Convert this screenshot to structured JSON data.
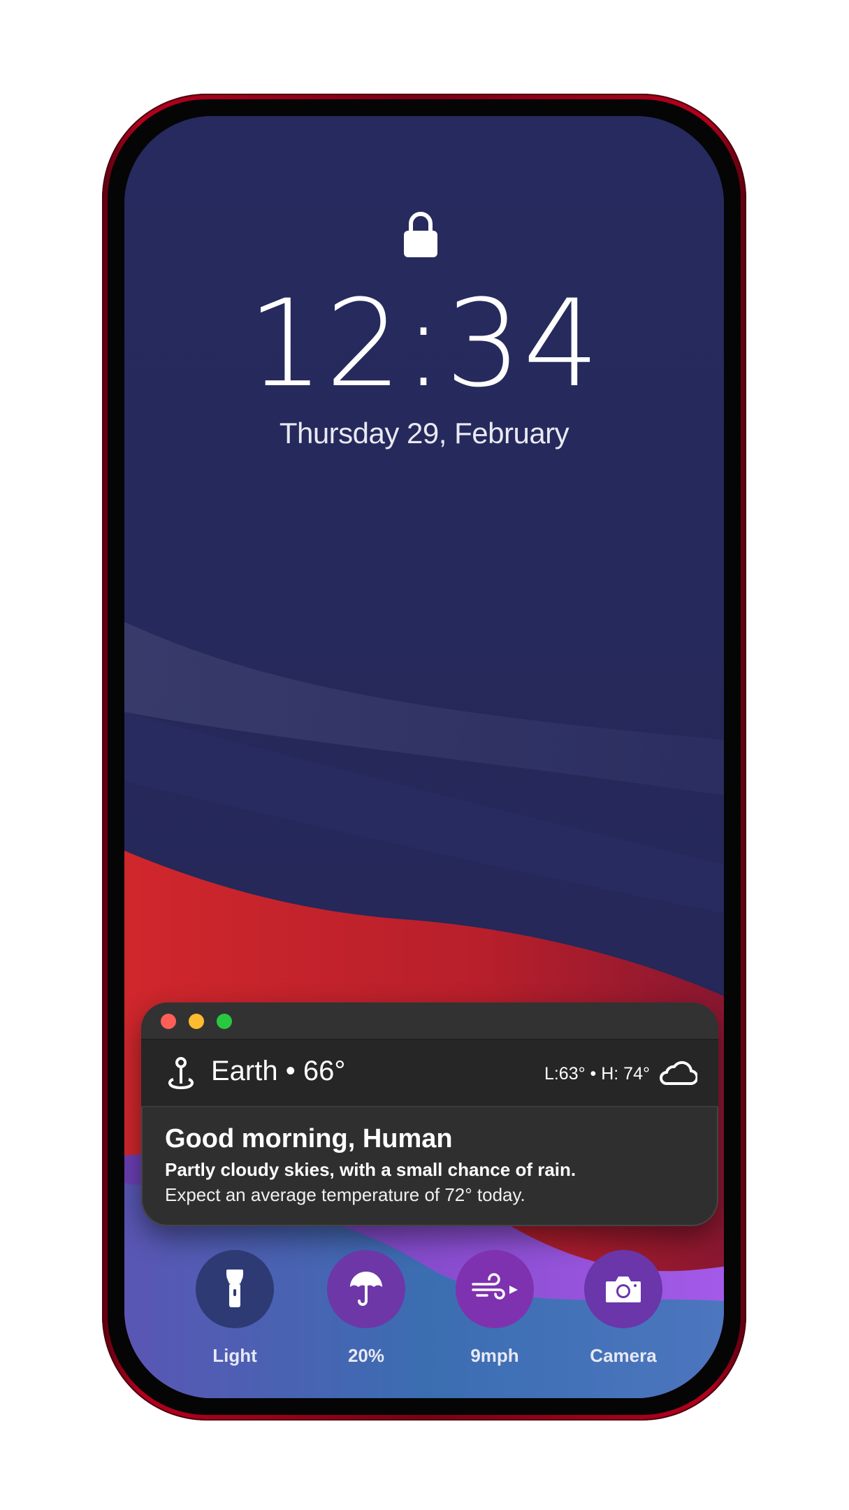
{
  "lockscreen": {
    "time": "12:34",
    "date": "Thursday 29, February"
  },
  "widget": {
    "location": "Earth • 66°",
    "low_high": "L:63° • H: 74°",
    "greeting": "Good morning, Human",
    "forecast": "Partly cloudy skies, with a small chance of rain.",
    "detail": "Expect an average temperature of 72° today.",
    "weather_icon": "cloud-icon"
  },
  "actions": [
    {
      "label": "Light",
      "icon": "flashlight-icon",
      "color": "#2d3a74"
    },
    {
      "label": "20%",
      "icon": "umbrella-icon",
      "color": "#6d37a8"
    },
    {
      "label": "9mph",
      "icon": "wind-icon",
      "color": "#7f32b0"
    },
    {
      "label": "Camera",
      "icon": "camera-icon",
      "color": "#6a36aa"
    }
  ],
  "colors": {
    "frame": "#b3001e",
    "wallpaper_top": "#24275a",
    "wave_red": "#c4262c",
    "wave_purple": "#8e4fd6",
    "wave_blue": "#3f6fb0"
  }
}
